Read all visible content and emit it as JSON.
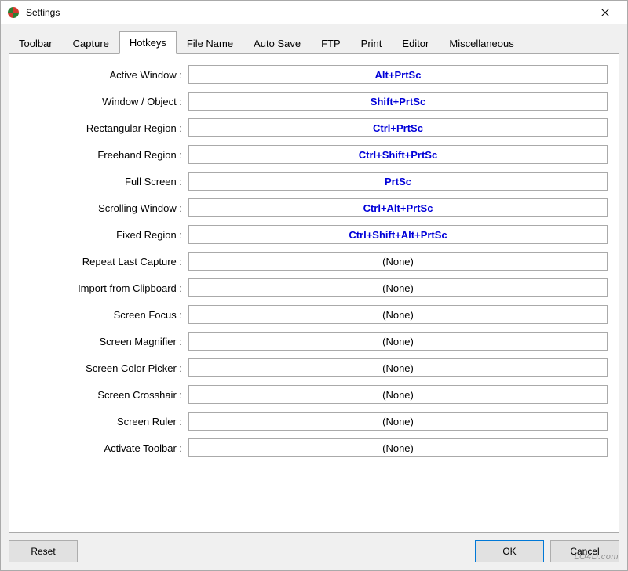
{
  "window": {
    "title": "Settings"
  },
  "tabs": [
    {
      "label": "Toolbar"
    },
    {
      "label": "Capture"
    },
    {
      "label": "Hotkeys"
    },
    {
      "label": "File Name"
    },
    {
      "label": "Auto Save"
    },
    {
      "label": "FTP"
    },
    {
      "label": "Print"
    },
    {
      "label": "Editor"
    },
    {
      "label": "Miscellaneous"
    }
  ],
  "active_tab_index": 2,
  "hotkeys": [
    {
      "label": "Active Window :",
      "value": "Alt+PrtSc",
      "assigned": true
    },
    {
      "label": "Window / Object :",
      "value": "Shift+PrtSc",
      "assigned": true
    },
    {
      "label": "Rectangular Region :",
      "value": "Ctrl+PrtSc",
      "assigned": true
    },
    {
      "label": "Freehand Region :",
      "value": "Ctrl+Shift+PrtSc",
      "assigned": true
    },
    {
      "label": "Full Screen :",
      "value": "PrtSc",
      "assigned": true
    },
    {
      "label": "Scrolling Window :",
      "value": "Ctrl+Alt+PrtSc",
      "assigned": true
    },
    {
      "label": "Fixed Region :",
      "value": "Ctrl+Shift+Alt+PrtSc",
      "assigned": true
    },
    {
      "label": "Repeat Last Capture :",
      "value": "(None)",
      "assigned": false
    },
    {
      "label": "Import from Clipboard :",
      "value": "(None)",
      "assigned": false
    },
    {
      "label": "Screen Focus :",
      "value": "(None)",
      "assigned": false
    },
    {
      "label": "Screen Magnifier :",
      "value": "(None)",
      "assigned": false
    },
    {
      "label": "Screen Color Picker :",
      "value": "(None)",
      "assigned": false
    },
    {
      "label": "Screen Crosshair :",
      "value": "(None)",
      "assigned": false
    },
    {
      "label": "Screen Ruler :",
      "value": "(None)",
      "assigned": false
    },
    {
      "label": "Activate Toolbar :",
      "value": "(None)",
      "assigned": false
    }
  ],
  "buttons": {
    "reset": "Reset",
    "ok": "OK",
    "cancel": "Cancel"
  },
  "watermark": "LO4D.com"
}
